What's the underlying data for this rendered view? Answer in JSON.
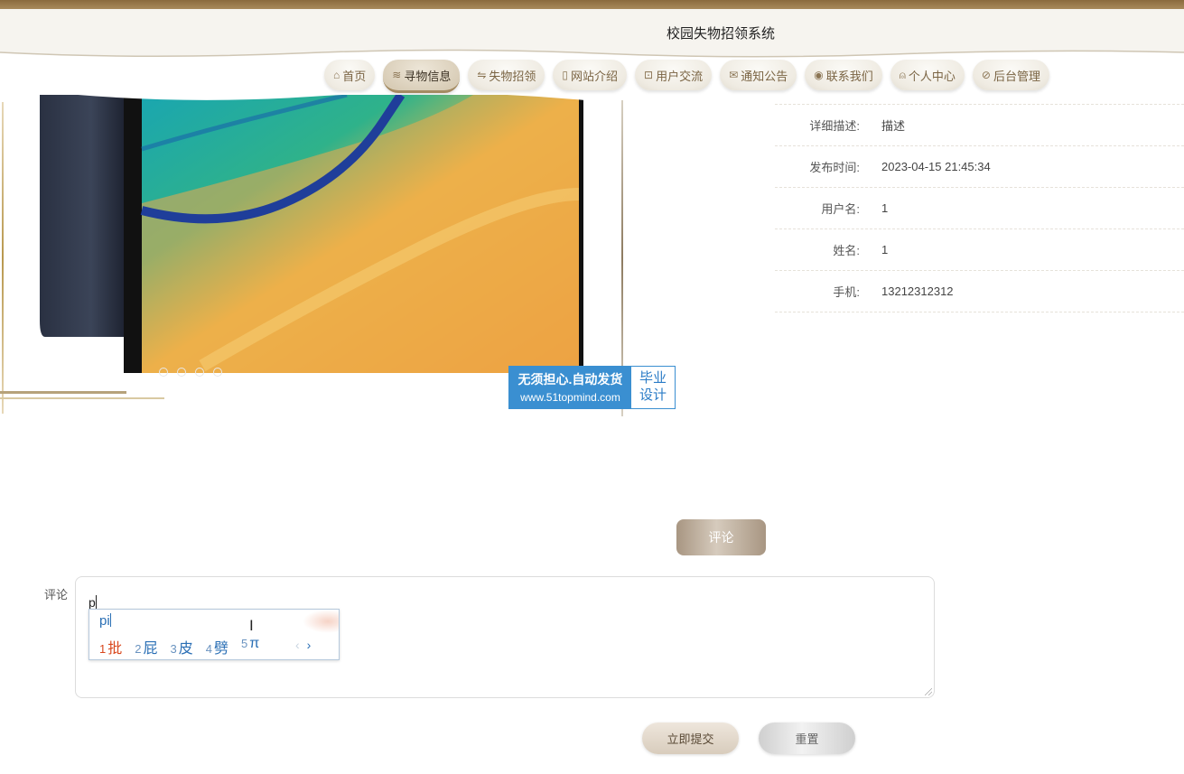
{
  "header": {
    "site_title": "校园失物招领系统"
  },
  "nav": {
    "items": [
      {
        "icon": "⌂",
        "label": "首页"
      },
      {
        "icon": "≋",
        "label": "寻物信息"
      },
      {
        "icon": "⇋",
        "label": "失物招领"
      },
      {
        "icon": "▯",
        "label": "网站介绍"
      },
      {
        "icon": "⊡",
        "label": "用户交流"
      },
      {
        "icon": "✉",
        "label": "通知公告"
      },
      {
        "icon": "◉",
        "label": "联系我们"
      },
      {
        "icon": "⍝",
        "label": "个人中心"
      },
      {
        "icon": "⊘",
        "label": "后台管理"
      }
    ],
    "active_index": 1
  },
  "details": [
    {
      "label": "详细描述:",
      "value": "描述"
    },
    {
      "label": "发布时间:",
      "value": "2023-04-15 21:45:34"
    },
    {
      "label": "用户名:",
      "value": "1"
    },
    {
      "label": "姓名:",
      "value": "1"
    },
    {
      "label": "手机:",
      "value": "13212312312"
    }
  ],
  "watermark": {
    "line1": "无须担心.自动发货",
    "line2": "www.51topmind.com",
    "badge_line1": "毕业",
    "badge_line2": "设计"
  },
  "comment_button_label": "评论",
  "comment_form": {
    "label": "评论",
    "value": "p",
    "ime": {
      "composition": "pi",
      "candidates": [
        {
          "n": "1",
          "text": "批"
        },
        {
          "n": "2",
          "text": "屁"
        },
        {
          "n": "3",
          "text": "皮"
        },
        {
          "n": "4",
          "text": "劈"
        },
        {
          "n": "5",
          "text": "π"
        }
      ],
      "prev": "‹",
      "next": "›"
    },
    "submit_label": "立即提交",
    "reset_label": "重置"
  },
  "colors": {
    "accent": "#a48b62",
    "nav_text": "#7a6443",
    "ime_blue": "#2a6fb5",
    "ime_selected": "#d9481e"
  }
}
